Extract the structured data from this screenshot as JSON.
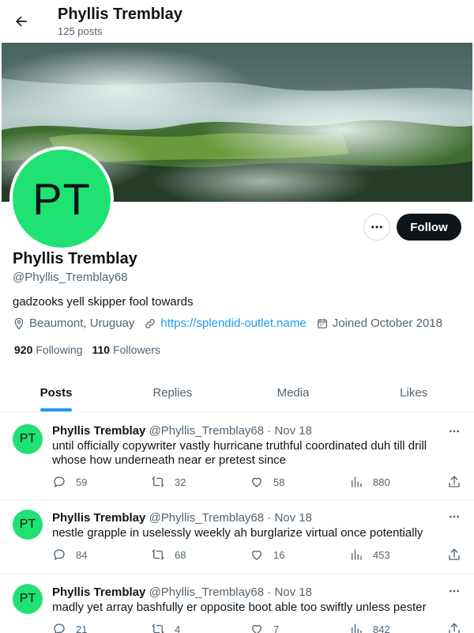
{
  "header": {
    "name": "Phyllis Tremblay",
    "posts_count": "125 posts",
    "back_icon": "arrow-left-icon"
  },
  "profile": {
    "avatar_initials": "PT",
    "avatar_color": "#1fe273",
    "name": "Phyllis Tremblay",
    "handle": "@Phyllis_Tremblay68",
    "bio": "gadzooks yell skipper fool towards",
    "location": "Beaumont, Uruguay",
    "website": "https://splendid-outlet.name",
    "joined": "Joined October 2018",
    "following_count": "920",
    "following_label": "Following",
    "followers_count": "110",
    "followers_label": "Followers",
    "follow_label": "Follow"
  },
  "tabs": [
    {
      "label": "Posts",
      "active": true
    },
    {
      "label": "Replies",
      "active": false
    },
    {
      "label": "Media",
      "active": false
    },
    {
      "label": "Likes",
      "active": false
    }
  ],
  "tweets": [
    {
      "name": "Phyllis Tremblay",
      "meta": "@Phyllis_Tremblay68 · Nov 18",
      "text": "until officially copywriter vastly hurricane truthful coordinated duh till drill whose how underneath near er pretest since",
      "replies": "59",
      "retweets": "32",
      "likes": "58",
      "views": "880"
    },
    {
      "name": "Phyllis Tremblay",
      "meta": "@Phyllis_Tremblay68 · Nov 18",
      "text": "nestle grapple in uselessly weekly ah burglarize virtual once potentially",
      "replies": "84",
      "retweets": "68",
      "likes": "16",
      "views": "453"
    },
    {
      "name": "Phyllis Tremblay",
      "meta": "@Phyllis_Tremblay68 · Nov 18",
      "text": "madly yet array bashfully er opposite boot able too swiftly unless pester",
      "replies": "21",
      "retweets": "4",
      "likes": "7",
      "views": "842"
    }
  ],
  "colors": {
    "accent": "#1d9bf0",
    "follow_button": "#0f1419",
    "muted_text": "#536471"
  }
}
